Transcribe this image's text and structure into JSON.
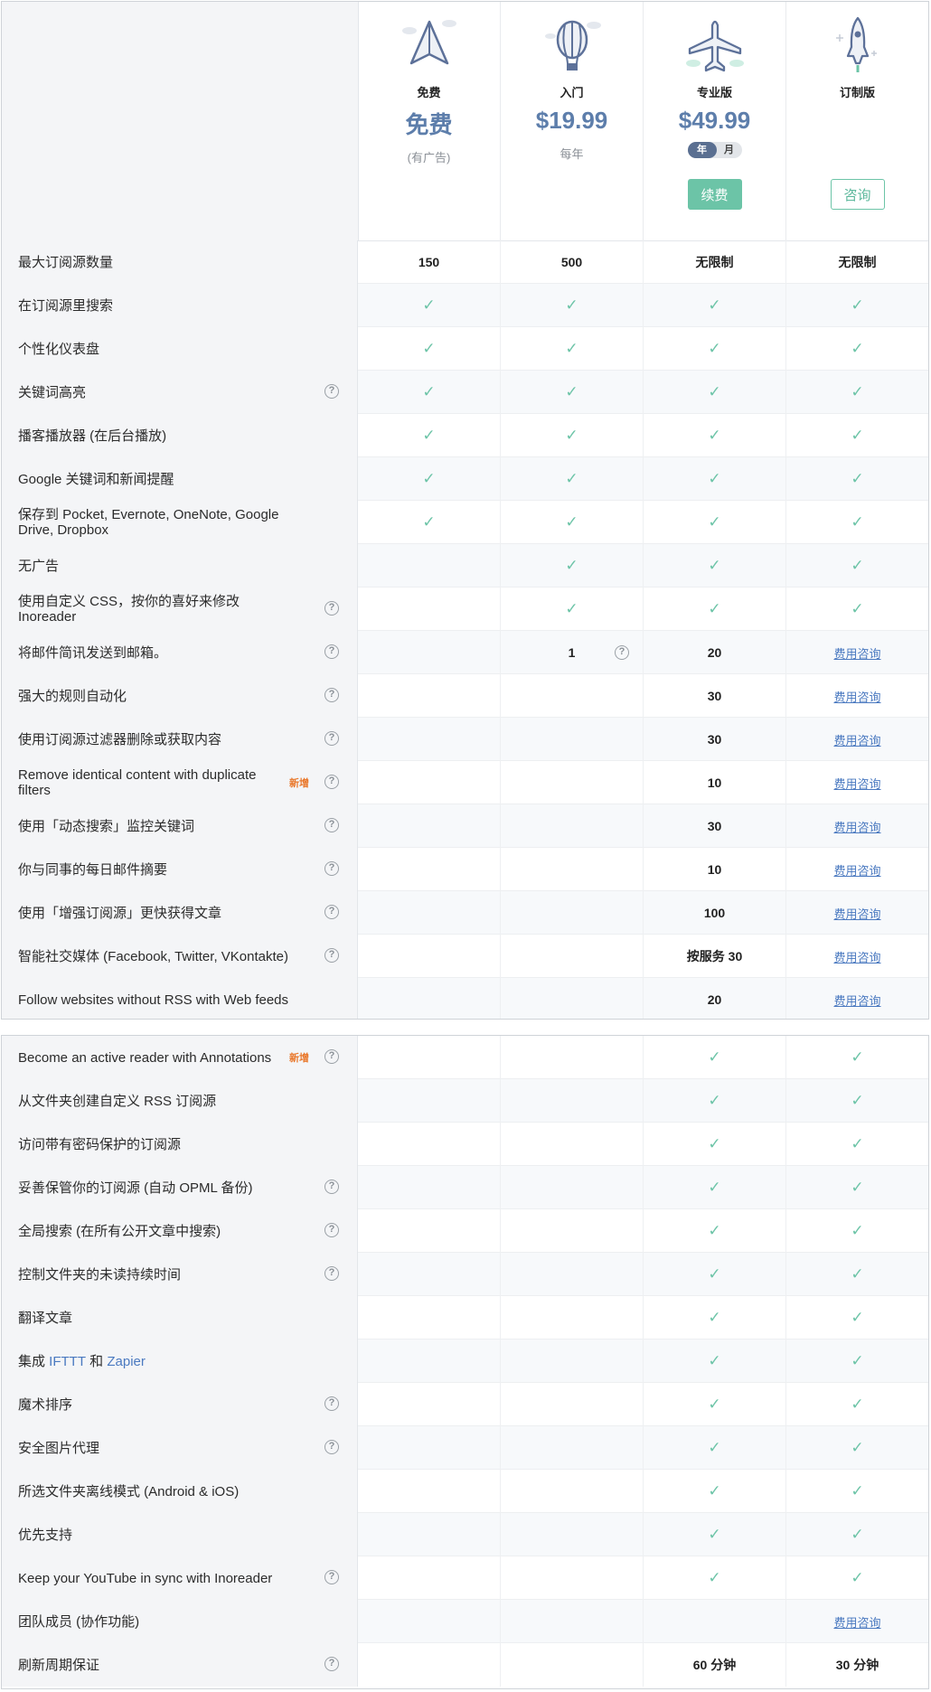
{
  "plans": [
    {
      "name": "免费",
      "price": "免费",
      "sub": "(有广告)",
      "icon": "paper-plane-icon"
    },
    {
      "name": "入门",
      "price": "$19.99",
      "sub": "每年",
      "icon": "hot-air-balloon-icon"
    },
    {
      "name": "专业版",
      "price": "$49.99",
      "toggle_year": "年",
      "toggle_month": "月",
      "button": "续费",
      "icon": "airplane-icon"
    },
    {
      "name": "订制版",
      "button": "咨询",
      "icon": "rocket-icon"
    }
  ],
  "colors": {
    "accent": "#6cc4a7",
    "price": "#5d7eab",
    "link": "#4a79c0",
    "new_badge": "#e9772a"
  },
  "check_icon": "✓",
  "help_icon": "?",
  "section1": [
    {
      "label": "最大订阅源数量",
      "help": false,
      "cells": [
        "150",
        "500",
        "无限制",
        "无限制"
      ]
    },
    {
      "label": "在订阅源里搜索",
      "help": false,
      "cells": [
        "check",
        "check",
        "check",
        "check"
      ]
    },
    {
      "label": "个性化仪表盘",
      "help": false,
      "cells": [
        "check",
        "check",
        "check",
        "check"
      ]
    },
    {
      "label": "关键词高亮",
      "help": true,
      "cells": [
        "check",
        "check",
        "check",
        "check"
      ]
    },
    {
      "label": "播客播放器 (在后台播放)",
      "help": false,
      "cells": [
        "check",
        "check",
        "check",
        "check"
      ]
    },
    {
      "label": "Google 关键词和新闻提醒",
      "help": false,
      "cells": [
        "check",
        "check",
        "check",
        "check"
      ]
    },
    {
      "label": "保存到 Pocket, Evernote, OneNote, Google Drive, Dropbox",
      "help": false,
      "cells": [
        "check",
        "check",
        "check",
        "check"
      ]
    },
    {
      "label": "无广告",
      "help": false,
      "cells": [
        "",
        "check",
        "check",
        "check"
      ]
    },
    {
      "label": "使用自定义 CSS，按你的喜好来修改 Inoreader",
      "help": true,
      "cells": [
        "",
        "check",
        "check",
        "check"
      ]
    },
    {
      "label": "将邮件简讯发送到邮箱。",
      "help": true,
      "cells": [
        "",
        "1",
        "20",
        "费用咨询"
      ],
      "cell_help": 1
    },
    {
      "label": "强大的规则自动化",
      "help": true,
      "cells": [
        "",
        "",
        "30",
        "费用咨询"
      ]
    },
    {
      "label": "使用订阅源过滤器删除或获取内容",
      "help": true,
      "cells": [
        "",
        "",
        "30",
        "费用咨询"
      ]
    },
    {
      "label": "Remove identical content with duplicate filters",
      "new": "新增",
      "help": true,
      "cells": [
        "",
        "",
        "10",
        "费用咨询"
      ]
    },
    {
      "label": "使用「动态搜索」监控关键词",
      "help": true,
      "cells": [
        "",
        "",
        "30",
        "费用咨询"
      ]
    },
    {
      "label": "你与同事的每日邮件摘要",
      "help": true,
      "cells": [
        "",
        "",
        "10",
        "费用咨询"
      ]
    },
    {
      "label": "使用「增强订阅源」更快获得文章",
      "help": true,
      "cells": [
        "",
        "",
        "100",
        "费用咨询"
      ]
    },
    {
      "label": "智能社交媒体 (Facebook, Twitter, VKontakte)",
      "help": true,
      "cells": [
        "",
        "",
        "按服务 30",
        "费用咨询"
      ]
    },
    {
      "label": "Follow websites without RSS with Web feeds",
      "help": false,
      "cells": [
        "",
        "",
        "20",
        "费用咨询"
      ]
    }
  ],
  "section2": [
    {
      "label": "Become an active reader with Annotations",
      "new": "新增",
      "help": true,
      "cells": [
        "",
        "",
        "check",
        "check"
      ]
    },
    {
      "label": "从文件夹创建自定义 RSS 订阅源",
      "help": false,
      "cells": [
        "",
        "",
        "check",
        "check"
      ]
    },
    {
      "label": "访问带有密码保护的订阅源",
      "help": false,
      "cells": [
        "",
        "",
        "check",
        "check"
      ]
    },
    {
      "label": "妥善保管你的订阅源 (自动 OPML 备份)",
      "help": true,
      "cells": [
        "",
        "",
        "check",
        "check"
      ]
    },
    {
      "label": "全局搜索 (在所有公开文章中搜索)",
      "help": true,
      "cells": [
        "",
        "",
        "check",
        "check"
      ]
    },
    {
      "label": "控制文件夹的未读持续时间",
      "help": true,
      "cells": [
        "",
        "",
        "check",
        "check"
      ]
    },
    {
      "label": "翻译文章",
      "help": false,
      "cells": [
        "",
        "",
        "check",
        "check"
      ]
    },
    {
      "label_parts": [
        "集成 ",
        "IFTTT",
        " 和 ",
        "Zapier"
      ],
      "help": false,
      "cells": [
        "",
        "",
        "check",
        "check"
      ]
    },
    {
      "label": "魔术排序",
      "help": true,
      "cells": [
        "",
        "",
        "check",
        "check"
      ]
    },
    {
      "label": "安全图片代理",
      "help": true,
      "cells": [
        "",
        "",
        "check",
        "check"
      ]
    },
    {
      "label": "所选文件夹离线模式 (Android & iOS)",
      "help": false,
      "cells": [
        "",
        "",
        "check",
        "check"
      ]
    },
    {
      "label": "优先支持",
      "help": false,
      "cells": [
        "",
        "",
        "check",
        "check"
      ]
    },
    {
      "label": "Keep your YouTube in sync with Inoreader",
      "help": true,
      "cells": [
        "",
        "",
        "check",
        "check"
      ]
    },
    {
      "label": "团队成员 (协作功能)",
      "help": false,
      "cells": [
        "",
        "",
        "",
        "费用咨询"
      ]
    },
    {
      "label": "刷新周期保证",
      "help": true,
      "cells": [
        "",
        "",
        "60 分钟",
        "30 分钟"
      ]
    }
  ]
}
